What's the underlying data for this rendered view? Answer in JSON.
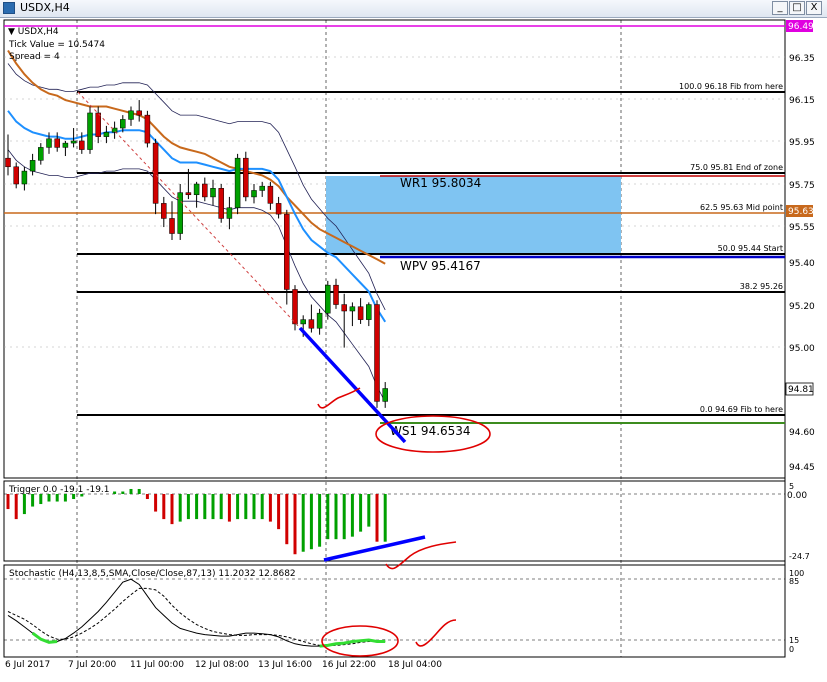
{
  "window": {
    "title": "USDX,H4",
    "minimize": "_",
    "maximize": "□",
    "close": "X"
  },
  "info": {
    "symbol": "USDX,H4",
    "tick_value": "Tick Value = 10.5474",
    "spread": "Spread = 4"
  },
  "price_axis": [
    "96.35",
    "96.15",
    "95.95",
    "95.75",
    "95.55",
    "95.40",
    "95.20",
    "95.00",
    "94.60",
    "94.45"
  ],
  "price_badges": {
    "top": "96.49",
    "mid_point": "95.63",
    "current": "94.81"
  },
  "fib_levels": [
    {
      "pct": "100.0",
      "price": "96.18",
      "note": "Fib from here"
    },
    {
      "pct": "75.0",
      "price": "95.81",
      "note": "End of zone"
    },
    {
      "pct": "62.5",
      "price": "95.63",
      "note": "Mid point"
    },
    {
      "pct": "50.0",
      "price": "95.44",
      "note": "Start"
    },
    {
      "pct": "38.2",
      "price": "95.26",
      "note": ""
    },
    {
      "pct": "0.0",
      "price": "94.69",
      "note": "Fib to here"
    }
  ],
  "pivots": {
    "wr1": "WR1   95.8034",
    "wpv": "WPV   95.4167",
    "ws1": "WS1   94.6534"
  },
  "trigger": {
    "label": "Trigger 0.0 -19.1 -19.1",
    "axis": [
      "5",
      "0.00",
      "-24.7"
    ]
  },
  "stochastic": {
    "label": "Stochastic (H4,13,8,5,SMA,Close/Close,87,13) 11.2032 12.8682",
    "axis": [
      "100",
      "85",
      "15",
      "0"
    ]
  },
  "time_axis": [
    "6 Jul 2017",
    "7 Jul 20:00",
    "11 Jul 00:00",
    "12 Jul 08:00",
    "13 Jul 16:00",
    "16 Jul 22:00",
    "18 Jul 04:00"
  ],
  "colors": {
    "bull": "#00a000",
    "bear": "#d00000",
    "zone": "#7fc4f2",
    "trend": "#0000ff",
    "fib": "#000000",
    "ma_orange": "#c8691c",
    "ma_blue": "#1e90ff",
    "support": "#3c8c1e"
  },
  "chart_data": {
    "type": "candlestick",
    "candles": [
      [
        95.88,
        95.99,
        95.8,
        95.84
      ],
      [
        95.84,
        95.86,
        95.74,
        95.76
      ],
      [
        95.76,
        95.84,
        95.73,
        95.82
      ],
      [
        95.82,
        95.9,
        95.8,
        95.87
      ],
      [
        95.87,
        95.95,
        95.85,
        95.93
      ],
      [
        95.93,
        96.0,
        95.9,
        95.97
      ],
      [
        95.97,
        96.0,
        95.91,
        95.93
      ],
      [
        95.93,
        95.96,
        95.89,
        95.95
      ],
      [
        95.95,
        96.02,
        95.93,
        95.96
      ],
      [
        95.96,
        96.0,
        95.9,
        95.92
      ],
      [
        95.92,
        96.12,
        95.9,
        96.09
      ],
      [
        96.09,
        96.12,
        95.95,
        95.98
      ],
      [
        95.98,
        96.03,
        95.95,
        96.0
      ],
      [
        96.0,
        96.05,
        95.97,
        96.02
      ],
      [
        96.02,
        96.08,
        96.0,
        96.06
      ],
      [
        96.06,
        96.12,
        96.03,
        96.1
      ],
      [
        96.1,
        96.15,
        96.05,
        96.08
      ],
      [
        96.08,
        96.1,
        95.93,
        95.95
      ],
      [
        95.95,
        95.97,
        95.62,
        95.67
      ],
      [
        95.67,
        95.7,
        95.56,
        95.6
      ],
      [
        95.6,
        95.68,
        95.5,
        95.53
      ],
      [
        95.53,
        95.76,
        95.5,
        95.72
      ],
      [
        95.72,
        95.83,
        95.69,
        95.71
      ],
      [
        95.71,
        95.77,
        95.65,
        95.76
      ],
      [
        95.76,
        95.79,
        95.68,
        95.7
      ],
      [
        95.7,
        95.78,
        95.66,
        95.74
      ],
      [
        95.74,
        95.76,
        95.58,
        95.6
      ],
      [
        95.6,
        95.7,
        95.55,
        95.65
      ],
      [
        95.65,
        95.9,
        95.62,
        95.88
      ],
      [
        95.88,
        95.91,
        95.68,
        95.7
      ],
      [
        95.7,
        95.76,
        95.67,
        95.73
      ],
      [
        95.73,
        95.77,
        95.7,
        95.75
      ],
      [
        95.75,
        95.77,
        95.64,
        95.67
      ],
      [
        95.67,
        95.7,
        95.6,
        95.62
      ],
      [
        95.62,
        95.64,
        95.2,
        95.27
      ],
      [
        95.27,
        95.29,
        95.08,
        95.11
      ],
      [
        95.11,
        95.15,
        95.05,
        95.13
      ],
      [
        95.13,
        95.2,
        95.07,
        95.09
      ],
      [
        95.09,
        95.18,
        95.06,
        95.16
      ],
      [
        95.16,
        95.31,
        95.13,
        95.29
      ],
      [
        95.29,
        95.32,
        95.18,
        95.2
      ],
      [
        95.2,
        95.25,
        95.0,
        95.17
      ],
      [
        95.17,
        95.21,
        95.1,
        95.19
      ],
      [
        95.19,
        95.23,
        95.11,
        95.13
      ],
      [
        95.13,
        95.21,
        95.1,
        95.2
      ],
      [
        95.2,
        95.22,
        94.72,
        94.75
      ],
      [
        94.75,
        94.84,
        94.72,
        94.81
      ]
    ],
    "ma_orange": [
      96.38,
      96.32,
      96.27,
      96.23,
      96.2,
      96.18,
      96.17,
      96.15,
      96.14,
      96.13,
      96.12,
      96.12,
      96.12,
      96.11,
      96.1,
      96.09,
      96.08,
      96.06,
      96.02,
      95.98,
      95.95,
      95.93,
      95.92,
      95.91,
      95.9,
      95.88,
      95.86,
      95.84,
      95.83,
      95.82,
      95.81,
      95.8,
      95.78,
      95.75,
      95.7,
      95.66,
      95.62,
      95.58,
      95.55,
      95.53,
      95.51,
      95.49,
      95.47,
      95.45,
      95.43,
      95.41,
      95.39
    ],
    "ma_blue": [
      96.1,
      96.05,
      96.02,
      96.0,
      95.99,
      95.98,
      95.98,
      95.97,
      95.97,
      95.98,
      95.99,
      95.99,
      96.0,
      96.0,
      96.01,
      96.01,
      96.01,
      96.0,
      95.96,
      95.92,
      95.88,
      95.86,
      95.86,
      95.86,
      95.85,
      95.84,
      95.83,
      95.82,
      95.83,
      95.83,
      95.83,
      95.83,
      95.82,
      95.78,
      95.7,
      95.62,
      95.55,
      95.5,
      95.47,
      95.44,
      95.42,
      95.38,
      95.34,
      95.3,
      95.26,
      95.18,
      95.12
    ],
    "trigger_values": [
      -6,
      -10,
      -8,
      -5,
      -4,
      -3,
      -3,
      -3,
      -2,
      -1,
      0,
      0,
      0,
      1,
      1,
      2,
      2,
      -2,
      -7,
      -10,
      -12,
      -11,
      -10,
      -10,
      -10,
      -10,
      -10,
      -11,
      -10,
      -10,
      -10,
      -10,
      -11,
      -14,
      -20,
      -24,
      -23,
      -22,
      -21,
      -18,
      -18,
      -18,
      -17,
      -15,
      -13,
      -19,
      -19
    ],
    "stoch_main": [
      45,
      38,
      30,
      22,
      14,
      10,
      11,
      15,
      22,
      30,
      40,
      50,
      62,
      75,
      88,
      92,
      85,
      70,
      55,
      45,
      35,
      28,
      25,
      22,
      20,
      19,
      18,
      18,
      20,
      22,
      22,
      21,
      20,
      17,
      12,
      8,
      6,
      5,
      5,
      6,
      8,
      9,
      11,
      12,
      13,
      11,
      11
    ],
    "stoch_signal": [
      50,
      45,
      40,
      33,
      25,
      18,
      14,
      14,
      17,
      22,
      28,
      35,
      44,
      53,
      63,
      72,
      80,
      80,
      78,
      70,
      58,
      48,
      40,
      33,
      28,
      24,
      22,
      20,
      19,
      19,
      20,
      20,
      20,
      19,
      17,
      14,
      11,
      8,
      6,
      6,
      6,
      7,
      8,
      10,
      11,
      12,
      13
    ]
  }
}
